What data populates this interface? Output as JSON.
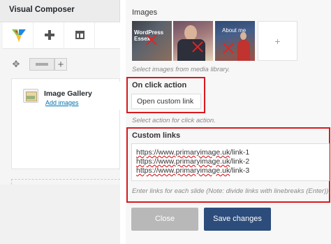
{
  "composer": {
    "title": "Visual Composer",
    "element": {
      "title": "Image Gallery",
      "subtitle": "Add images"
    }
  },
  "panel": {
    "images_label": "Images",
    "thumbnails": [
      {
        "caption": "WordPress Essex"
      },
      {
        "caption": ""
      },
      {
        "caption": "About me"
      }
    ],
    "add_image": "+",
    "images_help": "Select images from media library.",
    "on_click_label": "On click action",
    "on_click_value": "Open custom link",
    "on_click_help": "Select action for click action.",
    "custom_links_label": "Custom links",
    "custom_links": [
      {
        "url": "https://www.primaryimage.uk",
        "path": "/link-1"
      },
      {
        "url": "https://www.primaryimage.uk",
        "path": "/link-2"
      },
      {
        "url": "https://www.primaryimage.uk",
        "path": "/link-3"
      }
    ],
    "custom_links_help": "Enter links for each slide (Note: divide links with linebreaks (Enter)).",
    "close_label": "Close",
    "save_label": "Save changes"
  },
  "colors": {
    "highlight": "#d9191e",
    "save_button": "#2c4c7c",
    "link": "#0073aa"
  }
}
